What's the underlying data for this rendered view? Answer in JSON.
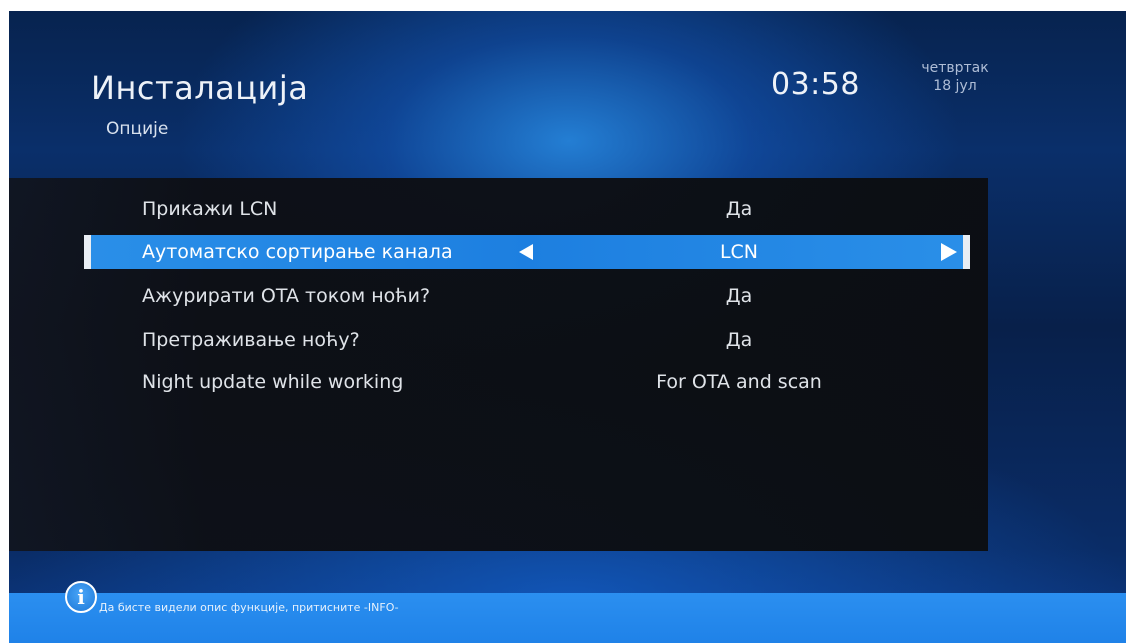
{
  "header": {
    "title": "Инсталација",
    "subtitle": "Опције",
    "time": "03:58",
    "day": "четвртак",
    "date": "18 јул"
  },
  "options": [
    {
      "label": "Прикажи LCN",
      "value": "Да"
    },
    {
      "label": "Аутоматско сортирање канала",
      "value": "LCN",
      "selected": true
    },
    {
      "label": "Ажурирати OTA током ноћи?",
      "value": "Да"
    },
    {
      "label": "Претраживање ноћу?",
      "value": "Да"
    },
    {
      "label": "Night update while working",
      "value": "For OTA and scan"
    }
  ],
  "footer": {
    "icon": "info-icon",
    "icon_glyph": "i",
    "hint": "Да бисте видели опис функције, притисните -INFO-"
  },
  "colors": {
    "selection": "#1d7fe0",
    "footer": "#1f82e8"
  }
}
